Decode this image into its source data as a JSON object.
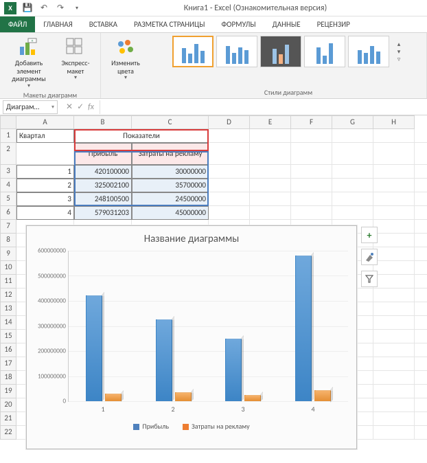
{
  "title_bar": "Книга1 - Excel (Ознакомительная версия)",
  "tabs": [
    "ФАЙЛ",
    "ГЛАВНАЯ",
    "ВСТАВКА",
    "РАЗМЕТКА СТРАНИЦЫ",
    "ФОРМУЛЫ",
    "ДАННЫЕ",
    "РЕЦЕНЗИР"
  ],
  "ribbon": {
    "add_element": "Добавить элемент диаграммы",
    "express_layout": "Экспресс-макет",
    "change_colors": "Изменить цвета",
    "group1": "Макеты диаграмм",
    "group2": "Стили диаграмм"
  },
  "namebox": "Диаграм…",
  "columns": [
    "A",
    "B",
    "C",
    "D",
    "E",
    "F",
    "G",
    "H"
  ],
  "grid": {
    "r1": {
      "A": "Квартал",
      "BC": "Показатели"
    },
    "r2": {
      "B": "Прибыль",
      "C": "Затраты на рекламу"
    },
    "r3": {
      "A": "1",
      "B": "420100000",
      "C": "30000000"
    },
    "r4": {
      "A": "2",
      "B": "325002100",
      "C": "35700000"
    },
    "r5": {
      "A": "3",
      "B": "248100500",
      "C": "24500000"
    },
    "r6": {
      "A": "4",
      "B": "579031203",
      "C": "45000000"
    }
  },
  "chart_data": {
    "type": "bar",
    "title": "Название диаграммы",
    "categories": [
      "1",
      "2",
      "3",
      "4"
    ],
    "series": [
      {
        "name": "Прибыль",
        "color": "#4f81bd",
        "values": [
          420100000,
          325002100,
          248100500,
          579031203
        ]
      },
      {
        "name": "Затраты на рекламу",
        "color": "#ed7d31",
        "values": [
          30000000,
          35700000,
          24500000,
          45000000
        ]
      }
    ],
    "ylim": [
      0,
      600000000
    ],
    "yticks": [
      0,
      100000000,
      200000000,
      300000000,
      400000000,
      500000000,
      600000000
    ],
    "xlabel": "",
    "ylabel": ""
  },
  "row_nums": [
    "1",
    "2",
    "3",
    "4",
    "5",
    "6",
    "7",
    "8",
    "9",
    "10",
    "11",
    "12",
    "13",
    "14",
    "15",
    "16",
    "17",
    "18",
    "19",
    "20",
    "21",
    "22"
  ]
}
